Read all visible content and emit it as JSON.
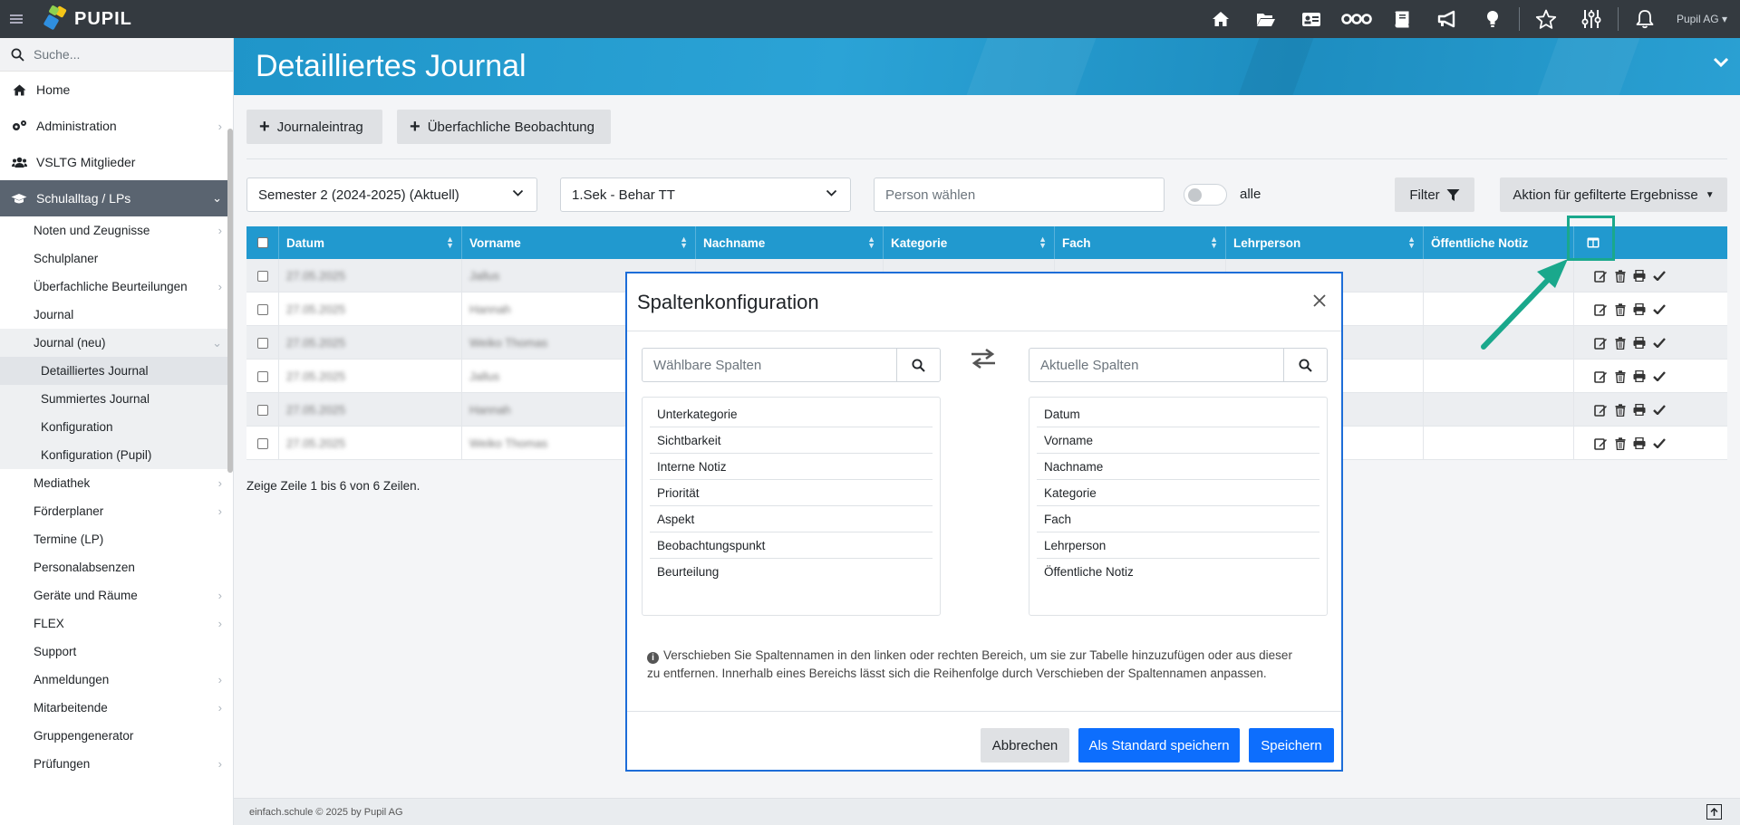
{
  "app": {
    "logo_text": "PUPIL",
    "user_menu": "Pupil AG"
  },
  "topnav_icons": [
    "home-icon",
    "folder-open-icon",
    "id-card-icon",
    "infinity-icon",
    "book-icon",
    "megaphone-icon",
    "lightbulb-icon",
    "star-icon",
    "sliders-icon",
    "bell-icon"
  ],
  "sidebar": {
    "search_placeholder": "Suche...",
    "main_items": [
      {
        "label": "Home",
        "icon": "home-icon"
      },
      {
        "label": "Administration",
        "icon": "cogs-icon"
      },
      {
        "label": "VSLTG Mitglieder",
        "icon": "users-icon"
      },
      {
        "label": "Schulalltag / LPs",
        "icon": "graduation-cap-icon"
      }
    ],
    "sub_items": {
      "noten": "Noten und Zeugnisse",
      "schulplaner": "Schulplaner",
      "ueberfachliche": "Überfachliche Beurteilungen",
      "journal": "Journal",
      "journal_neu": "Journal (neu)",
      "detailliertes": "Detailliertes Journal",
      "summiertes": "Summiertes Journal",
      "konfiguration": "Konfiguration",
      "konfiguration_pupil": "Konfiguration (Pupil)",
      "mediathek": "Mediathek",
      "foerderplaner": "Förderplaner",
      "termine": "Termine (LP)",
      "personalabsenzen": "Personalabsenzen",
      "geraete": "Geräte und Räume",
      "flex": "FLEX",
      "support": "Support",
      "anmeldungen": "Anmeldungen",
      "mitarbeitende": "Mitarbeitende",
      "gruppengenerator": "Gruppengenerator",
      "pruefungen": "Prüfungen"
    }
  },
  "page": {
    "title": "Detailliertes Journal"
  },
  "toolbar": {
    "journaleintrag": "Journaleintrag",
    "ueberfachliche_beobachtung": "Überfachliche Beobachtung",
    "semester_select": "Semester 2 (2024-2025) (Aktuell)",
    "class_select": "1.Sek - Behar TT",
    "person_placeholder": "Person wählen",
    "toggle_label": "alle",
    "filter_button": "Filter",
    "action_button": "Aktion für gefilterte Ergebnisse"
  },
  "table": {
    "headers": {
      "datum": "Datum",
      "vorname": "Vorname",
      "nachname": "Nachname",
      "kategorie": "Kategorie",
      "fach": "Fach",
      "lehrperson": "Lehrperson",
      "notiz": "Öffentliche Notiz"
    },
    "rows": [
      {
        "datum": "27.05.2025",
        "vorname": "Jallus"
      },
      {
        "datum": "27.05.2025",
        "vorname": "Hannah"
      },
      {
        "datum": "27.05.2025",
        "vorname": "Weiko Thomas"
      },
      {
        "datum": "27.05.2025",
        "vorname": "Jallus"
      },
      {
        "datum": "27.05.2025",
        "vorname": "Hannah"
      },
      {
        "datum": "27.05.2025",
        "vorname": "Weiko Thomas"
      }
    ],
    "info": "Zeige Zeile 1 bis 6 von 6 Zeilen."
  },
  "modal": {
    "title": "Spaltenkonfiguration",
    "left_search_placeholder": "Wählbare Spalten",
    "right_search_placeholder": "Aktuelle Spalten",
    "available_columns": [
      "Unterkategorie",
      "Sichtbarkeit",
      "Interne Notiz",
      "Priorität",
      "Aspekt",
      "Beobachtungspunkt",
      "Beurteilung"
    ],
    "current_columns": [
      "Datum",
      "Vorname",
      "Nachname",
      "Kategorie",
      "Fach",
      "Lehrperson",
      "Öffentliche Notiz"
    ],
    "info_text": "Verschieben Sie Spaltennamen in den linken oder rechten Bereich, um sie zur Tabelle hinzuzufügen oder aus dieser zu entfernen. Innerhalb eines Bereichs lässt sich die Reihenfolge durch Verschieben der Spaltennamen anpassen.",
    "cancel": "Abbrechen",
    "save_default": "Als Standard speichern",
    "save": "Speichern"
  },
  "footer": {
    "copyright": "einfach.schule © 2025 by Pupil AG"
  },
  "colors": {
    "topbar": "#343a40",
    "header_blue": "#2199cf",
    "primary": "#0d6efd",
    "highlight": "#1aa88c"
  }
}
